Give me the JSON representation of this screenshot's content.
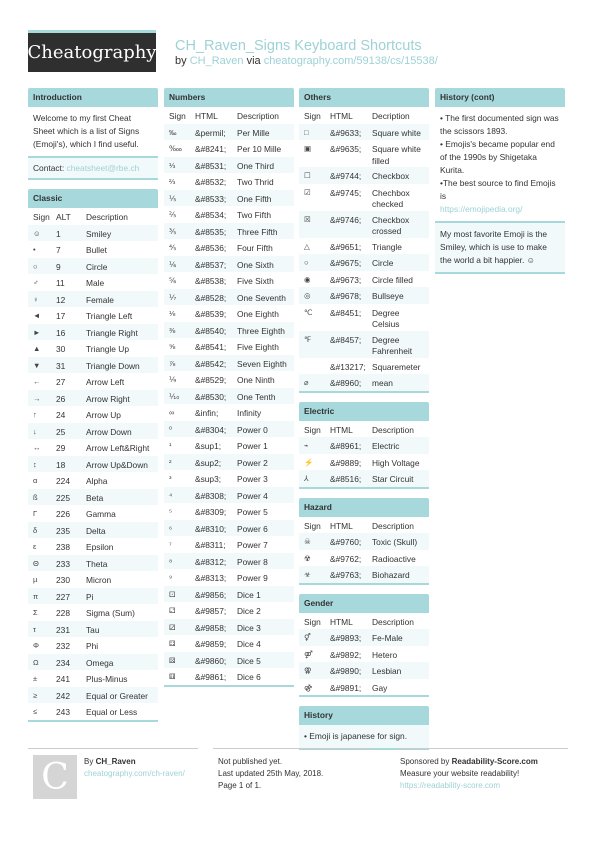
{
  "header": {
    "logo": "Cheatography",
    "title": "CH_Raven_Signs Keyboard Shortcuts",
    "by": "by",
    "author": "CH_Raven",
    "via": "via",
    "url": "cheatography.com/59138/cs/15538/"
  },
  "intro": {
    "title": "Introduction",
    "text": "Welcome to my first Cheat Sheet which is a list of Signs (Emoji's), which I find useful.",
    "contact_label": "Contact:",
    "contact_email": "cheatsheet@rbe.ch"
  },
  "classic": {
    "title": "Classic",
    "headers": [
      "Sign",
      "ALT",
      "Description"
    ],
    "rows": [
      [
        "☺",
        "1",
        "Smiley"
      ],
      [
        "•",
        "7",
        "Bullet"
      ],
      [
        "○",
        "9",
        "Circle"
      ],
      [
        "♂",
        "11",
        "Male"
      ],
      [
        "♀",
        "12",
        "Female"
      ],
      [
        "◄",
        "17",
        "Triangle Left"
      ],
      [
        "►",
        "16",
        "Triangle Right"
      ],
      [
        "▲",
        "30",
        "Triangle Up"
      ],
      [
        "▼",
        "31",
        "Triangle Down"
      ],
      [
        "←",
        "27",
        "Arrow Left"
      ],
      [
        "→",
        "26",
        "Arrow Right"
      ],
      [
        "↑",
        "24",
        "Arrow Up"
      ],
      [
        "↓",
        "25",
        "Arrow Down"
      ],
      [
        "↔",
        "29",
        "Arrow Left&Right"
      ],
      [
        "↕",
        "18",
        "Arrow Up&Down"
      ],
      [
        "α",
        "224",
        "Alpha"
      ],
      [
        "ß",
        "225",
        "Beta"
      ],
      [
        "Γ",
        "226",
        "Gamma"
      ],
      [
        "δ",
        "235",
        "Delta"
      ],
      [
        "ε",
        "238",
        "Epsilon"
      ],
      [
        "Θ",
        "233",
        "Theta"
      ],
      [
        "µ",
        "230",
        "Micron"
      ],
      [
        "π",
        "227",
        "Pi"
      ],
      [
        "Σ",
        "228",
        "Sigma (Sum)"
      ],
      [
        "τ",
        "231",
        "Tau"
      ],
      [
        "Φ",
        "232",
        "Phi"
      ],
      [
        "Ω",
        "234",
        "Omega"
      ],
      [
        "±",
        "241",
        "Plus-Minus"
      ],
      [
        "≥",
        "242",
        "Equal or Greater"
      ],
      [
        "≤",
        "243",
        "Equal or Less"
      ]
    ]
  },
  "numbers": {
    "title": "Numbers",
    "headers": [
      "Sign",
      "HTML",
      "Description"
    ],
    "rows": [
      [
        "‰",
        "&permil;",
        "Per Mille"
      ],
      [
        "‱",
        "&#8241;",
        "Per 10 Mille"
      ],
      [
        "⅓",
        "&#8531;",
        "One Third"
      ],
      [
        "⅔",
        "&#8532;",
        "Two Thrid"
      ],
      [
        "⅕",
        "&#8533;",
        "One Fifth"
      ],
      [
        "⅖",
        "&#8534;",
        "Two Fifth"
      ],
      [
        "⅗",
        "&#8535;",
        "Three Fifth"
      ],
      [
        "⅘",
        "&#8536;",
        "Four Fifth"
      ],
      [
        "⅙",
        "&#8537;",
        "One Sixth"
      ],
      [
        "⅚",
        "&#8538;",
        "Five Sixth"
      ],
      [
        "⅐",
        "&#8528;",
        "One Seventh"
      ],
      [
        "⅛",
        "&#8539;",
        "One Eighth"
      ],
      [
        "⅜",
        "&#8540;",
        "Three Eighth"
      ],
      [
        "⅝",
        "&#8541;",
        "Five Eighth"
      ],
      [
        "⅞",
        "&#8542;",
        "Seven Eighth"
      ],
      [
        "⅑",
        "&#8529;",
        "One Ninth"
      ],
      [
        "⅒",
        "&#8530;",
        "One Tenth"
      ],
      [
        "∞",
        "&infin;",
        "Infinity"
      ],
      [
        "⁰",
        "&#8304;",
        "Power 0"
      ],
      [
        "¹",
        "&sup1;",
        "Power 1"
      ],
      [
        "²",
        "&sup2;",
        "Power 2"
      ],
      [
        "³",
        "&sup3;",
        "Power 3"
      ],
      [
        "⁴",
        "&#8308;",
        "Power 4"
      ],
      [
        "⁵",
        "&#8309;",
        "Power 5"
      ],
      [
        "⁶",
        "&#8310;",
        "Power 6"
      ],
      [
        "⁷",
        "&#8311;",
        "Power 7"
      ],
      [
        "⁸",
        "&#8312;",
        "Power 8"
      ],
      [
        "⁹",
        "&#8313;",
        "Power 9"
      ],
      [
        "⚀",
        "&#9856;",
        "Dice 1"
      ],
      [
        "⚁",
        "&#9857;",
        "Dice 2"
      ],
      [
        "⚂",
        "&#9858;",
        "Dice 3"
      ],
      [
        "⚃",
        "&#9859;",
        "Dice 4"
      ],
      [
        "⚄",
        "&#9860;",
        "Dice 5"
      ],
      [
        "⚅",
        "&#9861;",
        "Dice 6"
      ]
    ]
  },
  "others": {
    "title": "Others",
    "headers": [
      "Sign",
      "HTML",
      "Decription"
    ],
    "rows": [
      [
        "□",
        "&#9633;",
        "Square white"
      ],
      [
        "▣",
        "&#9635;",
        "Square white filled"
      ],
      [
        "☐",
        "&#9744;",
        "Checkbox"
      ],
      [
        "☑",
        "&#9745;",
        "Chechbox checked"
      ],
      [
        "☒",
        "&#9746;",
        "Checkbox crossed"
      ],
      [
        "△",
        "&#9651;",
        "Triangle"
      ],
      [
        "○",
        "&#9675;",
        "Circle"
      ],
      [
        "◉",
        "&#9673;",
        "Circle filled"
      ],
      [
        "◎",
        "&#9678;",
        "Bullseye"
      ],
      [
        "℃",
        "&#8451;",
        "Degree Celsius"
      ],
      [
        "℉",
        "&#8457;",
        "Degree Fahrenheit"
      ],
      [
        "",
        "&#13217;",
        "Squaremeter"
      ],
      [
        "⌀",
        "&#8960;",
        "mean"
      ]
    ]
  },
  "electric": {
    "title": "Electric",
    "headers": [
      "Sign",
      "HTML",
      "Description"
    ],
    "rows": [
      [
        "⌁",
        "&#8961;",
        "Electric"
      ],
      [
        "⚡",
        "&#9889;",
        "High Voltage"
      ],
      [
        "⅄",
        "&#8516;",
        "Star Circuit"
      ]
    ]
  },
  "hazard": {
    "title": "Hazard",
    "headers": [
      "Sign",
      "HTML",
      "Description"
    ],
    "rows": [
      [
        "☠",
        "&#9760;",
        "Toxic (Skull)"
      ],
      [
        "☢",
        "&#9762;",
        "Radioactive"
      ],
      [
        "☣",
        "&#9763;",
        "Biohazard"
      ]
    ]
  },
  "gender": {
    "title": "Gender",
    "headers": [
      "Sign",
      "HTML",
      "Description"
    ],
    "rows": [
      [
        "⚥",
        "&#9893;",
        "Fe-Male"
      ],
      [
        "⚤",
        "&#9892;",
        "Hetero"
      ],
      [
        "⚢",
        "&#9890;",
        "Lesbian"
      ],
      [
        "⚣",
        "&#9891;",
        "Gay"
      ]
    ]
  },
  "history": {
    "title": "History",
    "text": "• Emoji is japanese for sign."
  },
  "history_cont": {
    "title": "History (cont)",
    "line1": "• The first documented sign was the scissors 1893.",
    "line2": "• Emojis's became popular end of the 1990s by Shigetaka Kurita.",
    "line3": "•The best source to find Emojis is",
    "link": "https://emojipedia.org/",
    "favorite": "My most favorite Emoji is the Smiley, which is use to make the world a bit happier. ☺"
  },
  "footer": {
    "avatar_letter": "C",
    "by": "By",
    "author": "CH_Raven",
    "author_url": "cheatography.com/ch-raven/",
    "published": "Not published yet.",
    "updated": "Last updated 25th May, 2018.",
    "page": "Page 1 of 1.",
    "sponsored_by": "Sponsored by",
    "sponsor": "Readability-Score.com",
    "sponsor_tagline": "Measure your website readability!",
    "sponsor_url": "https://readability-score.com"
  }
}
